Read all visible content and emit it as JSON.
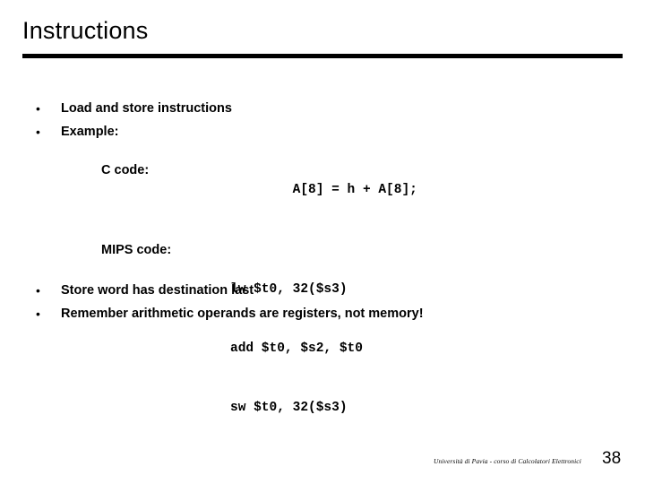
{
  "slide": {
    "title": "Instructions",
    "bullet_marker": "•",
    "bullets_top": [
      {
        "text": "Load and store instructions"
      },
      {
        "text": "Example:"
      }
    ],
    "bullets_bottom": [
      {
        "text": "Store word has destination last"
      },
      {
        "text": "Remember arithmetic operands are registers, not memory!"
      }
    ],
    "example": {
      "c": {
        "label": "C code:",
        "lines": [
          "A[8] = h + A[8];"
        ]
      },
      "mips": {
        "label": "MIPS code:",
        "lines": [
          "lw $t0, 32($s3)",
          "add $t0, $s2, $t0",
          "sw $t0, 32($s3)"
        ]
      }
    },
    "footer": {
      "credit": "Università di Pavia  - corso di Calcolatori Elettronici",
      "page_number": "38"
    },
    "colors": {
      "background": "#ffffff",
      "text": "#000000",
      "rule": "#000000"
    }
  }
}
